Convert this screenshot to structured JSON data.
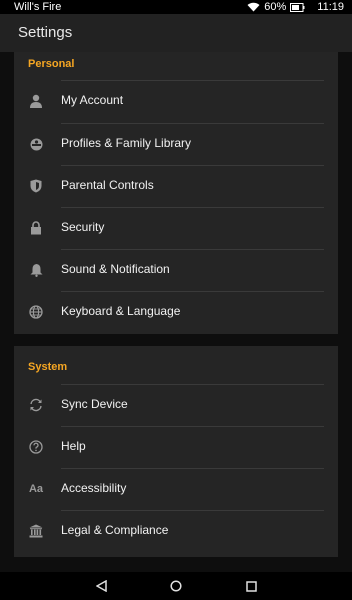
{
  "status_bar": {
    "device_name": "Will's Fire",
    "battery": "60%",
    "time": "11:19"
  },
  "app_bar": {
    "title": "Settings"
  },
  "accent_color": "#f5a623",
  "personal": {
    "header": "Personal",
    "items": [
      {
        "label": "My Account",
        "icon": "person-icon"
      },
      {
        "label": "Profiles & Family Library",
        "icon": "profile-icon"
      },
      {
        "label": "Parental Controls",
        "icon": "shield-icon"
      },
      {
        "label": "Security",
        "icon": "lock-icon"
      },
      {
        "label": "Sound & Notification",
        "icon": "bell-icon"
      },
      {
        "label": "Keyboard & Language",
        "icon": "globe-icon"
      }
    ]
  },
  "system": {
    "header": "System",
    "items": [
      {
        "label": "Sync Device",
        "icon": "sync-icon"
      },
      {
        "label": "Help",
        "icon": "help-icon"
      },
      {
        "label": "Accessibility",
        "icon": "text-size-icon",
        "glyph": "Aa"
      },
      {
        "label": "Legal & Compliance",
        "icon": "bank-icon"
      }
    ]
  }
}
